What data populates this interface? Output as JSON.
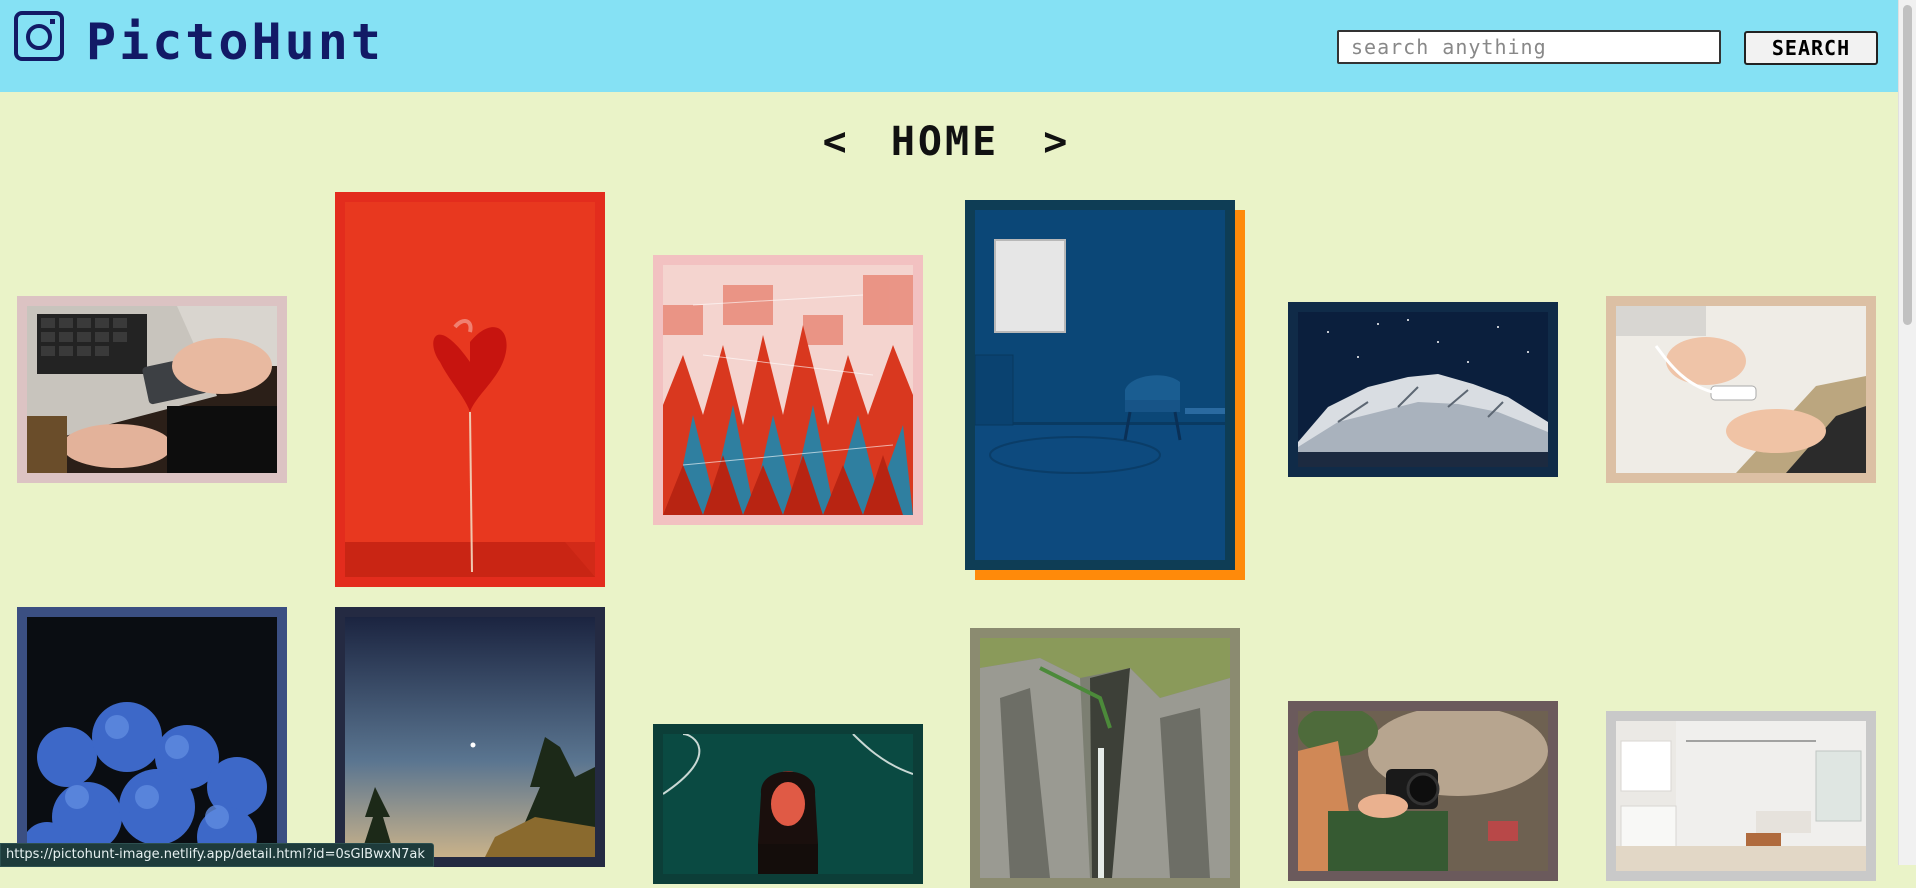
{
  "header": {
    "logo_text": "PictoHunt",
    "logo_icon": "camera-icon",
    "background_color": "#85e1f4",
    "logo_color": "#121a66"
  },
  "search": {
    "placeholder": "search anything",
    "value": "",
    "button_label": "SEARCH"
  },
  "nav": {
    "prev_label": "<",
    "title": "HOME",
    "next_label": ">"
  },
  "gallery": {
    "images": [
      {
        "subject": "hand holding portable SSD beside laptop",
        "frame_color": "#dcc3c3"
      },
      {
        "subject": "red heart balloon against red wall",
        "frame_color": "#e32c1d"
      },
      {
        "subject": "abstract red blue glitch art",
        "frame_color": "#f2c1c1"
      },
      {
        "subject": "blue room with chair and frame",
        "frame_color": "#0e3d55",
        "accent_color": "#ff8a0a"
      },
      {
        "subject": "snowy mountain under starry sky",
        "frame_color": "#102b48"
      },
      {
        "subject": "hands plugging cable adapter",
        "frame_color": "#dcc0a4"
      },
      {
        "subject": "blue hydrangea flowers",
        "frame_color": "#3b4f82"
      },
      {
        "subject": "pine trees at dusk with moon",
        "frame_color": "#242a42"
      },
      {
        "subject": "woman portrait in green light",
        "frame_color": "#0c3e38"
      },
      {
        "subject": "canyon waterfall aerial view",
        "frame_color": "#8b8b70"
      },
      {
        "subject": "hand holding camera on rocks",
        "frame_color": "#6b5a5c"
      },
      {
        "subject": "white minimalist living room",
        "frame_color": "#c9c9c9"
      }
    ]
  },
  "status_bar": {
    "url": "https://pictohunt-image.netlify.app/detail.html?id=0sGlBwxN7ak"
  }
}
